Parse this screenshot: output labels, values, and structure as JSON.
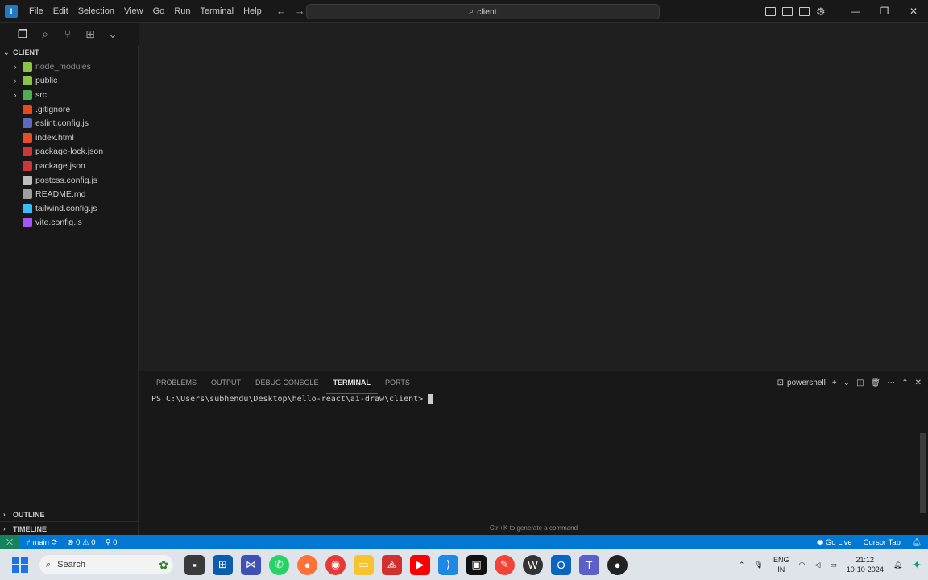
{
  "titlebar": {
    "menu": [
      "File",
      "Edit",
      "Selection",
      "View",
      "Go",
      "Run",
      "Terminal",
      "Help"
    ],
    "search": "client"
  },
  "sidebar": {
    "root": "CLIENT",
    "items": [
      {
        "label": "node_modules",
        "folder": true,
        "dim": true,
        "icon_color": "#8bc34a"
      },
      {
        "label": "public",
        "folder": true,
        "dim": false,
        "icon_color": "#8bc34a"
      },
      {
        "label": "src",
        "folder": true,
        "dim": false,
        "icon_color": "#4caf50"
      },
      {
        "label": ".gitignore",
        "folder": false,
        "dim": false,
        "icon_color": "#e64a19"
      },
      {
        "label": "eslint.config.js",
        "folder": false,
        "dim": false,
        "icon_color": "#5c6bc0"
      },
      {
        "label": "index.html",
        "folder": false,
        "dim": false,
        "icon_color": "#e44d26"
      },
      {
        "label": "package-lock.json",
        "folder": false,
        "dim": false,
        "icon_color": "#cb3837"
      },
      {
        "label": "package.json",
        "folder": false,
        "dim": false,
        "icon_color": "#cb3837"
      },
      {
        "label": "postcss.config.js",
        "folder": false,
        "dim": false,
        "icon_color": "#bdbdbd"
      },
      {
        "label": "README.md",
        "folder": false,
        "dim": false,
        "icon_color": "#9e9e9e"
      },
      {
        "label": "tailwind.config.js",
        "folder": false,
        "dim": false,
        "icon_color": "#38bdf8"
      },
      {
        "label": "vite.config.js",
        "folder": false,
        "dim": false,
        "icon_color": "#a855f7"
      }
    ],
    "outline": "OUTLINE",
    "timeline": "TIMELINE"
  },
  "panel": {
    "tabs": [
      "PROBLEMS",
      "OUTPUT",
      "DEBUG CONSOLE",
      "TERMINAL",
      "PORTS"
    ],
    "active_tab": "TERMINAL",
    "shell": "powershell",
    "prompt": "PS C:\\Users\\subhendu\\Desktop\\hello-react\\ai-draw\\client>",
    "hint": "Ctrl+K to generate a command"
  },
  "statusbar": {
    "branch": "main",
    "errors": "0",
    "warnings": "0",
    "ports": "0",
    "go_live": "Go Live",
    "cursor_tab": "Cursor Tab"
  },
  "taskbar": {
    "search": "Search",
    "lang": "ENG",
    "region": "IN",
    "time": "21:12",
    "date": "10-10-2024"
  }
}
